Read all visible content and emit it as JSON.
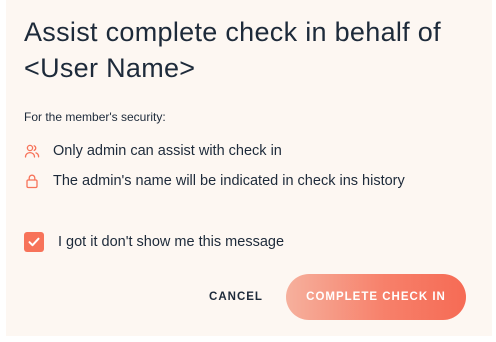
{
  "dialog": {
    "title": "Assist complete check in behalf of <User Name>",
    "security_label": "For the member's security:",
    "reasons": [
      {
        "icon": "users-icon",
        "text": "Only admin can assist with check in"
      },
      {
        "icon": "lock-icon",
        "text": "The admin's name will be indicated in check ins history"
      }
    ],
    "dont_show": {
      "checked": true,
      "label": "I got it don't show me this message"
    },
    "buttons": {
      "cancel": "CANCEL",
      "complete": "COMPLETE CHECK IN"
    }
  },
  "colors": {
    "accent": "#f7735a",
    "text": "#1d2a3a",
    "dialog_background": "#fdf7f2"
  }
}
